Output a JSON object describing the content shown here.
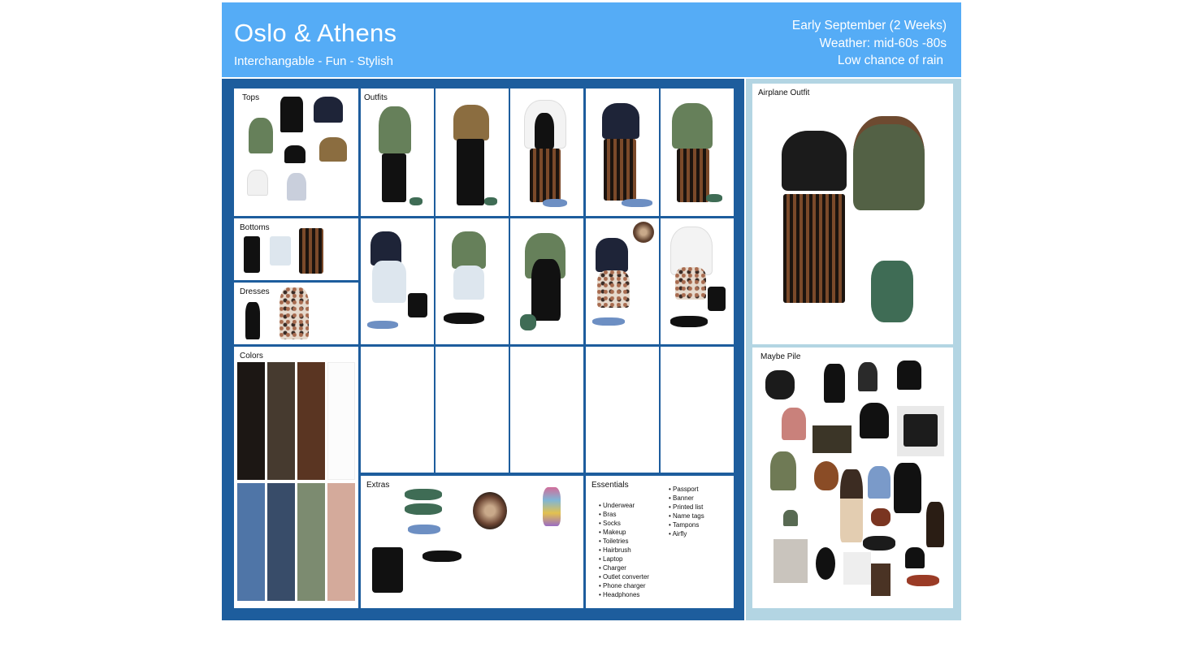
{
  "header": {
    "title": "Oslo & Athens",
    "subtitle": "Interchangable - Fun - Stylish",
    "dates": "Early September (2 Weeks)",
    "weather": "Weather: mid-60s -80s",
    "rain": "Low chance of rain"
  },
  "sections": {
    "tops": "Tops",
    "outfits": "Outfits",
    "bottoms": "Bottoms",
    "dresses": "Dresses",
    "colors": "Colors",
    "extras": "Extras",
    "essentials": "Essentials",
    "airplane": "Airplane Outfit",
    "maybe": "Maybe Pile"
  },
  "colors": {
    "palette": [
      "#1c1714",
      "#463a2f",
      "#5a3522",
      "#fcfcfc",
      "#4f75a7",
      "#384c69",
      "#7c8b70",
      "#d4aa9b"
    ],
    "header_blue": "#55acf6",
    "board_blue": "#1d5d9d",
    "side_blue": "#b3d5e3"
  },
  "essentials": {
    "list_left": [
      "Underwear",
      "Bras",
      "Socks",
      "Makeup",
      "Toiletries",
      "Hairbrush",
      "Laptop",
      "Charger",
      "Outlet converter",
      "Phone charger",
      "Headphones"
    ],
    "list_right": [
      "Passport",
      "Banner",
      "Printed list",
      "Name tags",
      "Tampons",
      "Airfly"
    ]
  }
}
